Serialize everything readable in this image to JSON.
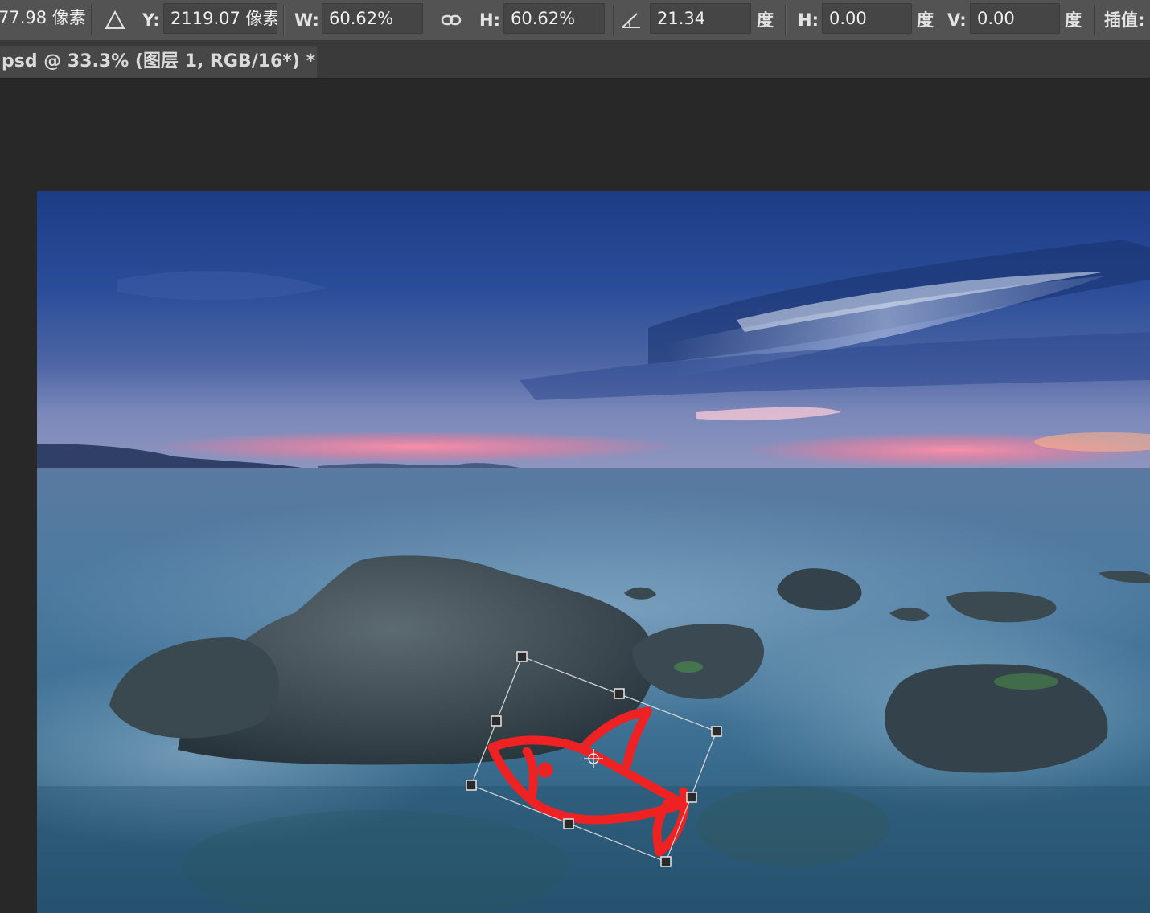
{
  "options_bar": {
    "x_value": "77.98 像素",
    "y_label": "Y:",
    "y_value": "2119.07 像素",
    "w_label": "W:",
    "w_value": "60.62%",
    "h_label": "H:",
    "h_value": "60.62%",
    "angle_value": "21.34",
    "angle_unit": "度",
    "skew_h_label": "H:",
    "skew_h_value": "0.00",
    "skew_h_unit": "度",
    "skew_v_label": "V:",
    "skew_v_value": "0.00",
    "skew_v_unit": "度",
    "interp_label": "插值:"
  },
  "document": {
    "tab_title": "psd @ 33.3% (图层 1, RGB/16*) *"
  },
  "icons": {
    "reference_point": "triangle-icon",
    "link": "chain-link-icon",
    "rotate": "angle-icon",
    "pivot": "crosshair-icon"
  },
  "colors": {
    "ui_bar": "#535353",
    "canvas_bg": "#282828",
    "drawing_stroke": "#ee2222"
  }
}
